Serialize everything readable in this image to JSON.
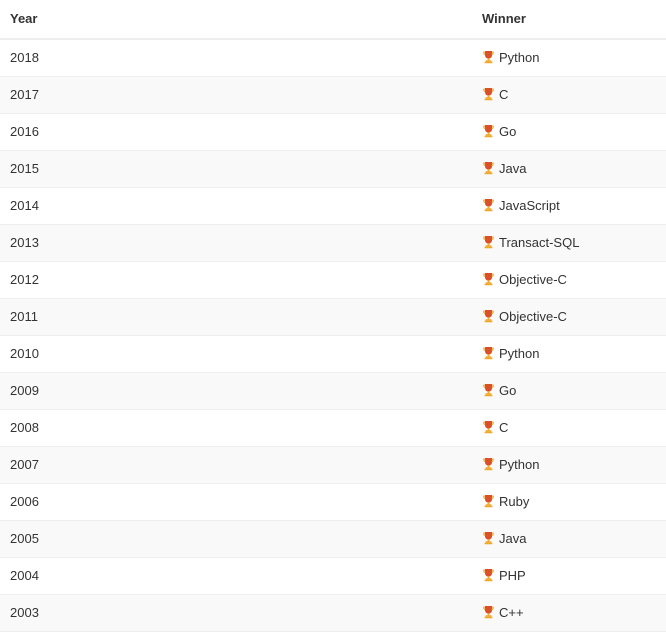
{
  "table": {
    "columns": [
      {
        "key": "year",
        "label": "Year"
      },
      {
        "key": "winner",
        "label": "Winner"
      }
    ],
    "icon": {
      "name": "trophy-icon",
      "glyph": "🏆",
      "cup_color": "#d9502b",
      "base_color": "#f0a82b"
    },
    "colors": {
      "text": "#333333",
      "row_odd_background": "#ffffff",
      "row_even_background": "#f9f9f9",
      "border": "#eeeeee",
      "page_background": "#ffffff"
    },
    "rows": [
      {
        "year": "2018",
        "winner": "Python"
      },
      {
        "year": "2017",
        "winner": "C"
      },
      {
        "year": "2016",
        "winner": "Go"
      },
      {
        "year": "2015",
        "winner": "Java"
      },
      {
        "year": "2014",
        "winner": "JavaScript"
      },
      {
        "year": "2013",
        "winner": "Transact-SQL"
      },
      {
        "year": "2012",
        "winner": "Objective-C"
      },
      {
        "year": "2011",
        "winner": "Objective-C"
      },
      {
        "year": "2010",
        "winner": "Python"
      },
      {
        "year": "2009",
        "winner": "Go"
      },
      {
        "year": "2008",
        "winner": "C"
      },
      {
        "year": "2007",
        "winner": "Python"
      },
      {
        "year": "2006",
        "winner": "Ruby"
      },
      {
        "year": "2005",
        "winner": "Java"
      },
      {
        "year": "2004",
        "winner": "PHP"
      },
      {
        "year": "2003",
        "winner": "C++"
      }
    ]
  }
}
